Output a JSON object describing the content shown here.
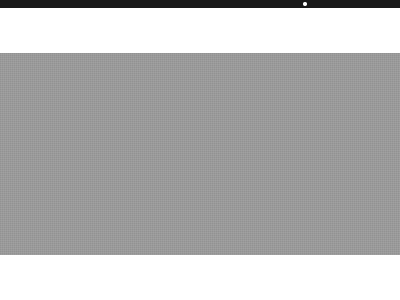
{
  "colors": {
    "top_bar": "#1a1a1a",
    "status_dot": "#ffffff",
    "page_background": "#ffffff",
    "overlay": "#9a9a9a"
  },
  "icons": {
    "status_indicator": "status-dot-icon"
  }
}
